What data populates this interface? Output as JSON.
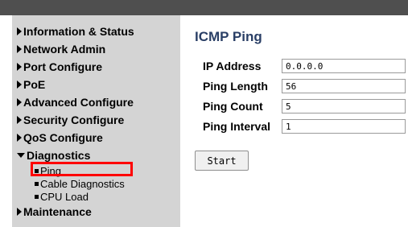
{
  "sidebar": {
    "items": [
      {
        "label": "Information & Status"
      },
      {
        "label": "Network Admin"
      },
      {
        "label": "Port Configure"
      },
      {
        "label": "PoE"
      },
      {
        "label": "Advanced Configure"
      },
      {
        "label": "Security Configure"
      },
      {
        "label": "QoS Configure"
      },
      {
        "label": "Diagnostics"
      },
      {
        "label": "Maintenance"
      }
    ],
    "diagnostics_sub": [
      {
        "label": "Ping"
      },
      {
        "label": "Cable Diagnostics"
      },
      {
        "label": "CPU Load"
      }
    ]
  },
  "main": {
    "title": "ICMP Ping",
    "fields": [
      {
        "label": "IP Address",
        "value": "0.0.0.0"
      },
      {
        "label": "Ping Length",
        "value": "56"
      },
      {
        "label": "Ping Count",
        "value": "5"
      },
      {
        "label": "Ping Interval",
        "value": "1"
      }
    ],
    "start_label": "Start"
  },
  "colors": {
    "topbar": "#4f4f4f",
    "sidebar_bg": "#d4d4d4",
    "title": "#2a3f66",
    "highlight": "#ff0000"
  }
}
